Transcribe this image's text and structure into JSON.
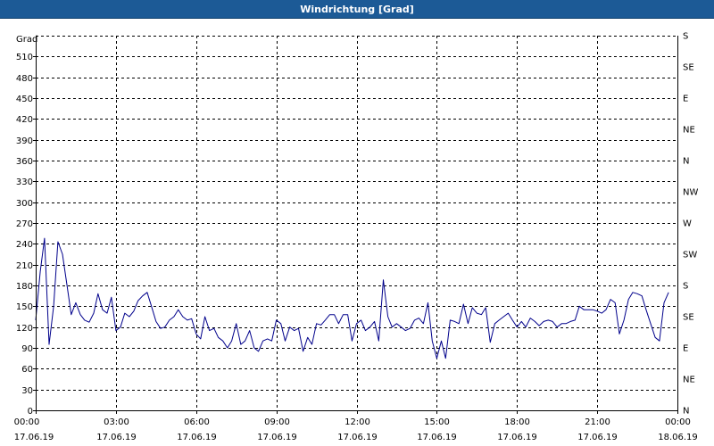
{
  "window": {
    "title": "Windrichtung [Grad]"
  },
  "chart_data": {
    "type": "line",
    "title": "Windrichtung [Grad]",
    "ylabel": "Grad",
    "ylim": [
      0,
      540
    ],
    "yticks": [
      0,
      30,
      60,
      90,
      120,
      150,
      180,
      210,
      240,
      270,
      300,
      330,
      360,
      390,
      420,
      450,
      480,
      510
    ],
    "y2_ticks": [
      "N",
      "NE",
      "E",
      "SE",
      "S",
      "SW",
      "W",
      "NW",
      "N",
      "NE",
      "E",
      "SE",
      "S"
    ],
    "x_ticks": [
      {
        "time": "00:00",
        "date": "17.06.19"
      },
      {
        "time": "03:00",
        "date": "17.06.19"
      },
      {
        "time": "06:00",
        "date": "17.06.19"
      },
      {
        "time": "09:00",
        "date": "17.06.19"
      },
      {
        "time": "12:00",
        "date": "17.06.19"
      },
      {
        "time": "15:00",
        "date": "17.06.19"
      },
      {
        "time": "18:00",
        "date": "17.06.19"
      },
      {
        "time": "21:00",
        "date": "17.06.19"
      },
      {
        "time": "00:00",
        "date": "18.06.19"
      }
    ],
    "grid": true,
    "colors": {
      "series": "#00008b",
      "grid": "#000000"
    },
    "series": [
      {
        "x_hours": [
          0,
          0.17,
          0.33,
          0.5,
          0.67,
          0.83,
          1,
          1.17,
          1.33,
          1.5,
          1.67,
          1.83,
          2,
          2.17,
          2.33,
          2.5,
          2.67,
          2.83,
          3,
          3.17,
          3.33,
          3.5,
          3.67,
          3.83,
          4,
          4.17,
          4.33,
          4.5,
          4.67,
          4.83,
          5,
          5.17,
          5.33,
          5.5,
          5.67,
          5.83,
          6,
          6.17,
          6.33,
          6.5,
          6.67,
          6.83,
          7,
          7.17,
          7.33,
          7.5,
          7.67,
          7.83,
          8,
          8.17,
          8.33,
          8.5,
          8.67,
          8.83,
          9,
          9.17,
          9.33,
          9.5,
          9.67,
          9.83,
          10,
          10.17,
          10.33,
          10.5,
          10.67,
          10.83,
          11,
          11.17,
          11.33,
          11.5,
          11.67,
          11.83,
          12,
          12.17,
          12.33,
          12.5,
          12.67,
          12.83,
          13,
          13.17,
          13.33,
          13.5,
          13.67,
          13.83,
          14,
          14.17,
          14.33,
          14.5,
          14.67,
          14.83,
          15,
          15.17,
          15.33,
          15.5,
          15.67,
          15.83,
          16,
          16.17,
          16.33,
          16.5,
          16.67,
          16.83,
          17,
          17.17,
          17.33,
          17.5,
          17.67,
          17.83,
          18,
          18.17,
          18.33,
          18.5,
          18.67,
          18.83,
          19,
          19.17,
          19.33,
          19.5,
          19.67,
          19.83,
          20,
          20.17,
          20.33,
          20.5,
          20.67,
          20.83,
          21,
          21.17,
          21.33,
          21.5,
          21.67,
          21.83,
          22,
          22.17,
          22.33,
          22.5,
          22.67,
          22.83,
          23,
          23.17,
          23.33,
          23.5,
          23.67,
          23.83,
          24
        ],
        "values": [
          130,
          200,
          248,
          95,
          150,
          243,
          225,
          180,
          138,
          155,
          138,
          130,
          127,
          140,
          168,
          145,
          140,
          163,
          115,
          120,
          140,
          135,
          143,
          158,
          165,
          170,
          150,
          128,
          118,
          120,
          130,
          135,
          145,
          135,
          130,
          132,
          110,
          103,
          135,
          115,
          118,
          105,
          100,
          90,
          100,
          125,
          95,
          100,
          115,
          90,
          85,
          100,
          103,
          100,
          130,
          125,
          100,
          120,
          115,
          118,
          85,
          105,
          95,
          125,
          123,
          130,
          138,
          138,
          125,
          138,
          138,
          100,
          125,
          130,
          115,
          120,
          128,
          100,
          188,
          135,
          120,
          125,
          120,
          115,
          118,
          130,
          133,
          125,
          155,
          100,
          75,
          100,
          75,
          130,
          128,
          125,
          153,
          125,
          148,
          140,
          138,
          148,
          98,
          125,
          130,
          135,
          140,
          130,
          120,
          128,
          120,
          133,
          128,
          122,
          128,
          130,
          128,
          120,
          125,
          125,
          128,
          130,
          150,
          145,
          145,
          145,
          143,
          140,
          145,
          160,
          155,
          110,
          130,
          160,
          170,
          168,
          165,
          145,
          125,
          105,
          100,
          155,
          170
        ]
      }
    ]
  }
}
